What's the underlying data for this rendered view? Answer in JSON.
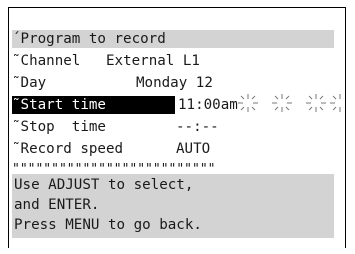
{
  "menu": {
    "title": "´Program to record",
    "rows": [
      {
        "label": "˜Channel",
        "value": "External L1"
      },
      {
        "label": "˜Day",
        "value": "Monday 12"
      },
      {
        "label": "˜Start time",
        "value": "11:00am"
      },
      {
        "label": "˜Stop  time",
        "value": "--:--"
      },
      {
        "label": "˜Record speed",
        "value": "AUTO"
      }
    ],
    "separator": "\"\"\"\"\"\"\"\"\"\"\"\"\"\"\"\"\"\"\"\"\"\"\"\"\"\""
  },
  "help": {
    "lines": [
      "Use ADJUST to select,",
      "and ENTER.",
      "Press MENU to go back."
    ]
  },
  "colors": {
    "band": "#d3d3d3",
    "highlight": "#000000",
    "highlight_text": "#ffffff"
  },
  "icons": {
    "blink_indicator": "blink-sparkle-icon"
  }
}
